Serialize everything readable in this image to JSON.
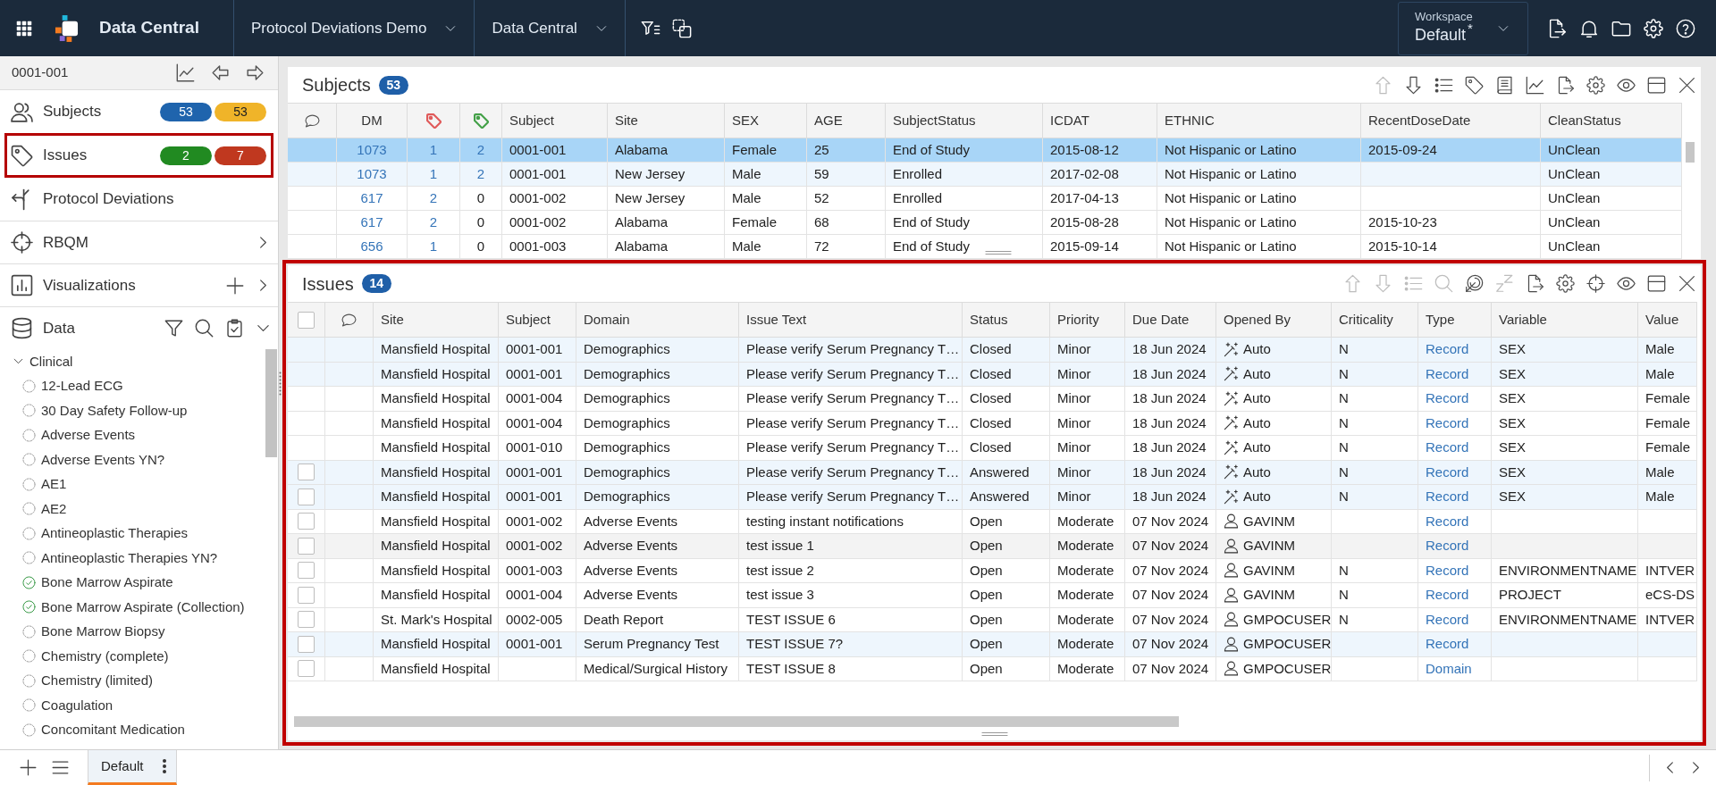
{
  "top_bar": {
    "app_title": "Data Central",
    "breadcrumbs": [
      {
        "label": "Protocol Deviations Demo"
      },
      {
        "label": "Data Central"
      }
    ],
    "workspace": {
      "label": "Workspace",
      "value": "Default",
      "modified_mark": "*"
    }
  },
  "sidebar": {
    "subject": "0001-001",
    "nav": [
      {
        "kind": "subjects",
        "label": "Subjects",
        "highlighted": false,
        "badges": [
          {
            "text": "53",
            "color": "#1f64ad"
          },
          {
            "text": "53",
            "color": "#f0b429"
          }
        ]
      },
      {
        "kind": "issues",
        "label": "Issues",
        "highlighted": true,
        "badges": [
          {
            "text": "2",
            "color": "#218a21"
          },
          {
            "text": "7",
            "color": "#c0381f"
          }
        ]
      },
      {
        "kind": "deviations",
        "label": "Protocol Deviations",
        "highlighted": false
      },
      {
        "kind": "rbqm",
        "label": "RBQM",
        "highlighted": false,
        "expanded": false
      },
      {
        "kind": "visualizations",
        "label": "Visualizations",
        "highlighted": false,
        "expanded": false
      },
      {
        "kind": "data",
        "label": "Data",
        "highlighted": false,
        "expanded": true
      }
    ],
    "tree": [
      {
        "label": "Clinical",
        "expanded": true,
        "children": [
          {
            "label": "12-Lead ECG",
            "complete": false
          },
          {
            "label": "30 Day Safety Follow-up",
            "complete": false
          },
          {
            "label": "Adverse Events",
            "complete": false
          },
          {
            "label": "Adverse Events YN?",
            "complete": false
          },
          {
            "label": "AE1",
            "complete": false
          },
          {
            "label": "AE2",
            "complete": false
          },
          {
            "label": "Antineoplastic Therapies",
            "complete": false
          },
          {
            "label": "Antineoplastic Therapies YN?",
            "complete": false
          },
          {
            "label": "Bone Marrow Aspirate",
            "complete": true
          },
          {
            "label": "Bone Marrow Aspirate (Collection)",
            "complete": true
          },
          {
            "label": "Bone Marrow Biopsy",
            "complete": false
          },
          {
            "label": "Chemistry (complete)",
            "complete": false
          },
          {
            "label": "Chemistry (limited)",
            "complete": false
          },
          {
            "label": "Coagulation",
            "complete": false
          },
          {
            "label": "Concomitant Medication",
            "complete": false
          }
        ]
      }
    ]
  },
  "subjects_panel": {
    "title": "Subjects",
    "count": "53",
    "highlighted": false,
    "toolbar": [
      {
        "kind": "move-up",
        "disabled": true
      },
      {
        "kind": "move-down",
        "disabled": false
      },
      {
        "kind": "list",
        "disabled": false
      },
      {
        "kind": "tag",
        "disabled": false
      },
      {
        "kind": "book",
        "disabled": false
      },
      {
        "kind": "chart",
        "disabled": false
      },
      {
        "kind": "export",
        "disabled": false
      },
      {
        "kind": "settings",
        "disabled": false
      },
      {
        "kind": "eye",
        "disabled": false
      },
      {
        "kind": "layout",
        "disabled": false
      },
      {
        "kind": "close",
        "disabled": false
      }
    ],
    "columns": [
      {
        "kind": "comment"
      },
      {
        "kind": "text",
        "label": "DM"
      },
      {
        "kind": "tag",
        "color": "#e05a5a"
      },
      {
        "kind": "tag",
        "color": "#43a047"
      },
      {
        "kind": "text",
        "label": "Subject"
      },
      {
        "kind": "text",
        "label": "Site"
      },
      {
        "kind": "text",
        "label": "SEX"
      },
      {
        "kind": "text",
        "label": "AGE"
      },
      {
        "kind": "text",
        "label": "SubjectStatus"
      },
      {
        "kind": "text",
        "label": "ICDAT"
      },
      {
        "kind": "text",
        "label": "ETHNIC"
      },
      {
        "kind": "text",
        "label": "RecentDoseDate"
      },
      {
        "kind": "text",
        "label": "CleanStatus"
      }
    ],
    "rows": [
      {
        "selected": true,
        "highlighted": false,
        "cells": [
          null,
          {
            "kind": "link",
            "text": "1073"
          },
          {
            "kind": "link",
            "text": "1"
          },
          {
            "kind": "link",
            "text": "2"
          },
          "0001-001",
          "Alabama",
          "Female",
          "25",
          "End of Study",
          "2015-08-12",
          "Not Hispanic or Latino",
          "2015-09-24",
          "UnClean"
        ]
      },
      {
        "selected": false,
        "highlighted": true,
        "cells": [
          null,
          {
            "kind": "link",
            "text": "1073"
          },
          {
            "kind": "link",
            "text": "1"
          },
          {
            "kind": "link",
            "text": "2"
          },
          "0001-001",
          "New Jersey",
          "Male",
          "59",
          "Enrolled",
          "2017-02-08",
          "Not Hispanic or Latino",
          null,
          "UnClean"
        ]
      },
      {
        "selected": false,
        "highlighted": false,
        "cells": [
          null,
          {
            "kind": "link",
            "text": "617"
          },
          {
            "kind": "link",
            "text": "2"
          },
          "0",
          "0001-002",
          "New Jersey",
          "Male",
          "52",
          "Enrolled",
          "2017-04-13",
          "Not Hispanic or Latino",
          null,
          "UnClean"
        ]
      },
      {
        "selected": false,
        "highlighted": false,
        "cells": [
          null,
          {
            "kind": "link",
            "text": "617"
          },
          {
            "kind": "link",
            "text": "2"
          },
          "0",
          "0001-002",
          "Alabama",
          "Female",
          "68",
          "End of Study",
          "2015-08-28",
          "Not Hispanic or Latino",
          "2015-10-23",
          "UnClean"
        ]
      },
      {
        "selected": false,
        "highlighted": false,
        "cells": [
          null,
          {
            "kind": "link",
            "text": "656"
          },
          {
            "kind": "link",
            "text": "1"
          },
          "0",
          "0001-003",
          "Alabama",
          "Male",
          "72",
          "End of Study",
          "2015-09-14",
          "Not Hispanic or Latino",
          "2015-10-14",
          "UnClean"
        ]
      }
    ]
  },
  "issues_panel": {
    "title": "Issues",
    "count": "14",
    "highlighted": true,
    "toolbar": [
      {
        "kind": "move-up",
        "disabled": true
      },
      {
        "kind": "move-down",
        "disabled": true
      },
      {
        "kind": "list",
        "disabled": true
      },
      {
        "kind": "search",
        "disabled": true
      },
      {
        "kind": "target",
        "disabled": false
      },
      {
        "kind": "sleep",
        "disabled": true
      },
      {
        "kind": "export",
        "disabled": false
      },
      {
        "kind": "settings",
        "disabled": false
      },
      {
        "kind": "crosshair",
        "disabled": false
      },
      {
        "kind": "eye",
        "disabled": false
      },
      {
        "kind": "layout",
        "disabled": false
      },
      {
        "kind": "close",
        "disabled": false
      }
    ],
    "columns": [
      {
        "kind": "select",
        "checked": false
      },
      {
        "kind": "comment"
      },
      {
        "kind": "text",
        "label": "Site"
      },
      {
        "kind": "text",
        "label": "Subject"
      },
      {
        "kind": "text",
        "label": "Domain"
      },
      {
        "kind": "text",
        "label": "Issue Text"
      },
      {
        "kind": "text",
        "label": "Status"
      },
      {
        "kind": "text",
        "label": "Priority"
      },
      {
        "kind": "text",
        "label": "Due Date"
      },
      {
        "kind": "text",
        "label": "Opened By"
      },
      {
        "kind": "text",
        "label": "Criticality"
      },
      {
        "kind": "text",
        "label": "Type"
      },
      {
        "kind": "text",
        "label": "Variable"
      },
      {
        "kind": "text",
        "label": "Value"
      }
    ],
    "rows": [
      {
        "highlighted": true,
        "hovered": false,
        "selectable": false,
        "checked": false,
        "cells": [
          null,
          null,
          "Mansfield Hospital",
          "0001-001",
          "Demographics",
          "Please verify Serum Pregnancy T…",
          "Closed",
          "Minor",
          "18 Jun 2024",
          {
            "kind": "auto",
            "text": "Auto"
          },
          "N",
          {
            "kind": "link",
            "text": "Record"
          },
          "SEX",
          "Male"
        ]
      },
      {
        "highlighted": true,
        "hovered": false,
        "selectable": false,
        "checked": false,
        "cells": [
          null,
          null,
          "Mansfield Hospital",
          "0001-001",
          "Demographics",
          "Please verify Serum Pregnancy T…",
          "Closed",
          "Minor",
          "18 Jun 2024",
          {
            "kind": "auto",
            "text": "Auto"
          },
          "N",
          {
            "kind": "link",
            "text": "Record"
          },
          "SEX",
          "Male"
        ]
      },
      {
        "highlighted": false,
        "hovered": false,
        "selectable": false,
        "checked": false,
        "cells": [
          null,
          null,
          "Mansfield Hospital",
          "0001-004",
          "Demographics",
          "Please verify Serum Pregnancy T…",
          "Closed",
          "Minor",
          "18 Jun 2024",
          {
            "kind": "auto",
            "text": "Auto"
          },
          "N",
          {
            "kind": "link",
            "text": "Record"
          },
          "SEX",
          "Female"
        ]
      },
      {
        "highlighted": false,
        "hovered": false,
        "selectable": false,
        "checked": false,
        "cells": [
          null,
          null,
          "Mansfield Hospital",
          "0001-004",
          "Demographics",
          "Please verify Serum Pregnancy T…",
          "Closed",
          "Minor",
          "18 Jun 2024",
          {
            "kind": "auto",
            "text": "Auto"
          },
          "N",
          {
            "kind": "link",
            "text": "Record"
          },
          "SEX",
          "Female"
        ]
      },
      {
        "highlighted": false,
        "hovered": false,
        "selectable": false,
        "checked": false,
        "cells": [
          null,
          null,
          "Mansfield Hospital",
          "0001-010",
          "Demographics",
          "Please verify Serum Pregnancy T…",
          "Closed",
          "Minor",
          "18 Jun 2024",
          {
            "kind": "auto",
            "text": "Auto"
          },
          "N",
          {
            "kind": "link",
            "text": "Record"
          },
          "SEX",
          "Female"
        ]
      },
      {
        "highlighted": true,
        "hovered": false,
        "selectable": true,
        "checked": false,
        "cells": [
          null,
          null,
          "Mansfield Hospital",
          "0001-001",
          "Demographics",
          "Please verify Serum Pregnancy T…",
          "Answered",
          "Minor",
          "18 Jun 2024",
          {
            "kind": "auto",
            "text": "Auto"
          },
          "N",
          {
            "kind": "link",
            "text": "Record"
          },
          "SEX",
          "Male"
        ]
      },
      {
        "highlighted": true,
        "hovered": false,
        "selectable": true,
        "checked": false,
        "cells": [
          null,
          null,
          "Mansfield Hospital",
          "0001-001",
          "Demographics",
          "Please verify Serum Pregnancy T…",
          "Answered",
          "Minor",
          "18 Jun 2024",
          {
            "kind": "auto",
            "text": "Auto"
          },
          "N",
          {
            "kind": "link",
            "text": "Record"
          },
          "SEX",
          "Male"
        ]
      },
      {
        "highlighted": false,
        "hovered": false,
        "selectable": true,
        "checked": false,
        "cells": [
          null,
          null,
          "Mansfield Hospital",
          "0001-002",
          "Adverse Events",
          "testing instant notifications",
          "Open",
          "Moderate",
          "07 Nov 2024",
          {
            "kind": "user",
            "text": "GAVINM"
          },
          null,
          {
            "kind": "link",
            "text": "Record"
          },
          null,
          null
        ]
      },
      {
        "highlighted": false,
        "hovered": true,
        "selectable": true,
        "checked": false,
        "cells": [
          null,
          null,
          "Mansfield Hospital",
          "0001-002",
          "Adverse Events",
          "test issue 1",
          "Open",
          "Moderate",
          "07 Nov 2024",
          {
            "kind": "user",
            "text": "GAVINM"
          },
          null,
          {
            "kind": "link",
            "text": "Record"
          },
          null,
          null
        ]
      },
      {
        "highlighted": false,
        "hovered": false,
        "selectable": true,
        "checked": false,
        "cells": [
          null,
          null,
          "Mansfield Hospital",
          "0001-003",
          "Adverse Events",
          "test issue 2",
          "Open",
          "Moderate",
          "07 Nov 2024",
          {
            "kind": "user",
            "text": "GAVINM"
          },
          "N",
          {
            "kind": "link",
            "text": "Record"
          },
          "ENVIRONMENTNAME",
          "INTVER"
        ]
      },
      {
        "highlighted": false,
        "hovered": false,
        "selectable": true,
        "checked": false,
        "cells": [
          null,
          null,
          "Mansfield Hospital",
          "0001-004",
          "Adverse Events",
          "test issue 3",
          "Open",
          "Moderate",
          "07 Nov 2024",
          {
            "kind": "user",
            "text": "GAVINM"
          },
          "N",
          {
            "kind": "link",
            "text": "Record"
          },
          "PROJECT",
          "eCS-DS"
        ]
      },
      {
        "highlighted": false,
        "hovered": false,
        "selectable": true,
        "checked": false,
        "cells": [
          null,
          null,
          "St. Mark's Hospital",
          "0002-005",
          "Death Report",
          "TEST ISSUE 6",
          "Open",
          "Moderate",
          "07 Nov 2024",
          {
            "kind": "user",
            "text": "GMPOCUSER"
          },
          "N",
          {
            "kind": "link",
            "text": "Record"
          },
          "ENVIRONMENTNAME",
          "INTVER"
        ]
      },
      {
        "highlighted": true,
        "hovered": false,
        "selectable": true,
        "checked": false,
        "cells": [
          null,
          null,
          "Mansfield Hospital",
          "0001-001",
          "Serum Pregnancy Test",
          "TEST ISSUE 7?",
          "Open",
          "Moderate",
          "07 Nov 2024",
          {
            "kind": "user",
            "text": "GMPOCUSER"
          },
          null,
          {
            "kind": "link",
            "text": "Record"
          },
          null,
          null
        ]
      },
      {
        "highlighted": false,
        "hovered": false,
        "selectable": true,
        "checked": false,
        "cells": [
          null,
          null,
          "Mansfield Hospital",
          null,
          "Medical/Surgical History",
          "TEST ISSUE 8",
          "Open",
          "Moderate",
          "07 Nov 2024",
          {
            "kind": "user",
            "text": "GMPOCUSER"
          },
          null,
          {
            "kind": "link",
            "text": "Domain"
          },
          null,
          null
        ]
      }
    ]
  },
  "bottom_bar": {
    "tabs": [
      {
        "label": "Default",
        "selected": true
      }
    ]
  }
}
